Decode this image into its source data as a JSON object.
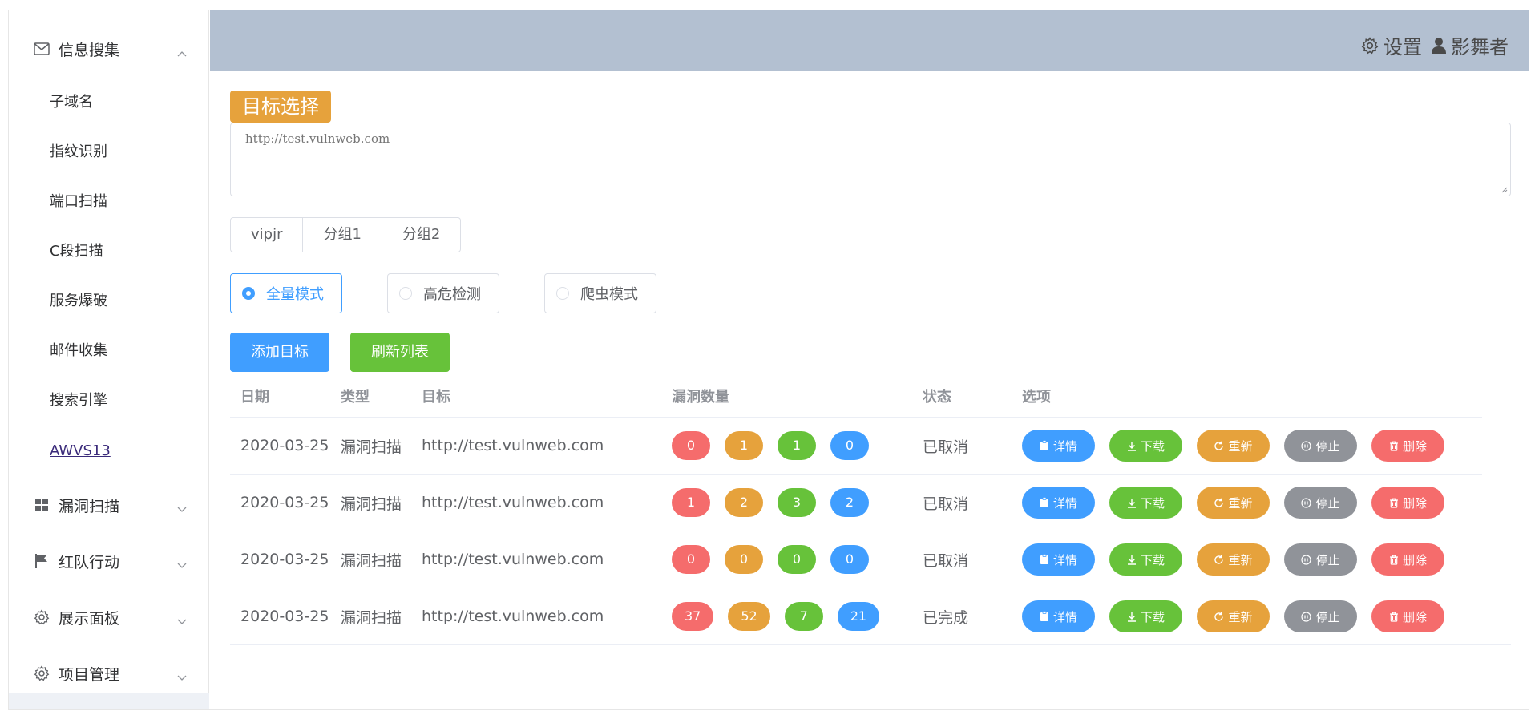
{
  "sidebar": {
    "groups": [
      {
        "label": "信息搜集",
        "icon": "mail-icon",
        "expanded": true
      },
      {
        "label": "漏洞扫描",
        "icon": "grid-icon",
        "expanded": false
      },
      {
        "label": "红队行动",
        "icon": "flag-icon",
        "expanded": false
      },
      {
        "label": "展示面板",
        "icon": "gear-icon",
        "expanded": false
      },
      {
        "label": "项目管理",
        "icon": "gear-icon",
        "expanded": false
      }
    ],
    "sub_items": [
      "子域名",
      "指纹识别",
      "端口扫描",
      "C段扫描",
      "服务爆破",
      "邮件收集",
      "搜索引擎",
      "AWVS13"
    ],
    "active_sub_item": "AWVS13"
  },
  "header": {
    "settings_label": "设置",
    "user_label": "影舞者"
  },
  "main": {
    "target_title": "目标选择",
    "target_placeholder": "http://test.vulnweb.com",
    "groups": [
      "vipjr",
      "分组1",
      "分组2"
    ],
    "modes": [
      {
        "label": "全量模式",
        "checked": true
      },
      {
        "label": "高危检测",
        "checked": false
      },
      {
        "label": "爬虫模式",
        "checked": false
      }
    ],
    "add_button": "添加目标",
    "refresh_button": "刷新列表"
  },
  "table": {
    "headers": {
      "date": "日期",
      "type": "类型",
      "target": "目标",
      "vulns": "漏洞数量",
      "status": "状态",
      "ops": "选项"
    },
    "ops_labels": {
      "detail": "详情",
      "download": "下载",
      "retry": "重新",
      "stop": "停止",
      "delete": "删除"
    },
    "rows": [
      {
        "date": "2020-03-25",
        "type": "漏洞扫描",
        "target": "http://test.vulnweb.com",
        "vulns": [
          "0",
          "1",
          "1",
          "0"
        ],
        "status": "已取消"
      },
      {
        "date": "2020-03-25",
        "type": "漏洞扫描",
        "target": "http://test.vulnweb.com",
        "vulns": [
          "1",
          "2",
          "3",
          "2"
        ],
        "status": "已取消"
      },
      {
        "date": "2020-03-25",
        "type": "漏洞扫描",
        "target": "http://test.vulnweb.com",
        "vulns": [
          "0",
          "0",
          "0",
          "0"
        ],
        "status": "已取消"
      },
      {
        "date": "2020-03-25",
        "type": "漏洞扫描",
        "target": "http://test.vulnweb.com",
        "vulns": [
          "37",
          "52",
          "7",
          "21"
        ],
        "status": "已完成"
      }
    ]
  },
  "colors": {
    "primary": "#409eff",
    "success": "#67c23a",
    "warning": "#e6a23c",
    "danger": "#f56c6c",
    "info": "#909399",
    "header_bg": "#b3c0d1"
  }
}
